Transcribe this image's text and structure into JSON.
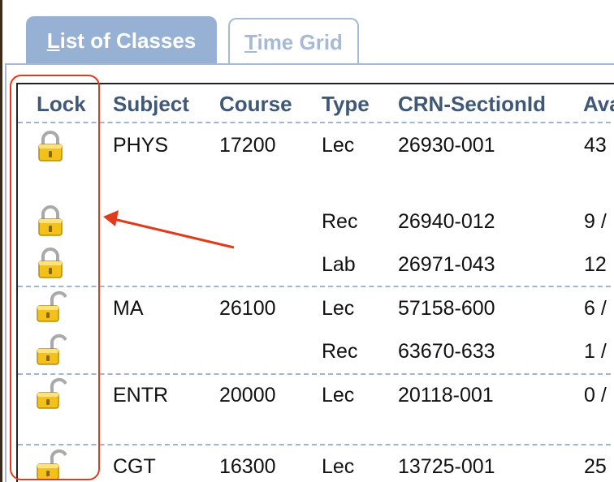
{
  "tabs": [
    {
      "label_u": "L",
      "label_rest": "ist of Classes",
      "active": true
    },
    {
      "label_u": "T",
      "label_rest": "ime Grid",
      "active": false
    }
  ],
  "table": {
    "headers": [
      "Lock",
      "Subject",
      "Course",
      "Type",
      "CRN-SectionId",
      "Ava"
    ],
    "rows": [
      {
        "lock": "locked",
        "subject": "PHYS",
        "course": "17200",
        "type": "Lec",
        "crn": "26930-001",
        "avail": "43"
      },
      {
        "lock": "locked",
        "subject": "",
        "course": "",
        "type": "Rec",
        "crn": "26940-012",
        "avail": "9 /"
      },
      {
        "lock": "locked",
        "subject": "",
        "course": "",
        "type": "Lab",
        "crn": "26971-043",
        "avail": "12"
      },
      {
        "lock": "unlocked",
        "subject": "MA",
        "course": "26100",
        "type": "Lec",
        "crn": "57158-600",
        "avail": "6 /"
      },
      {
        "lock": "unlocked",
        "subject": "",
        "course": "",
        "type": "Rec",
        "crn": "63670-633",
        "avail": "1 /"
      },
      {
        "lock": "unlocked",
        "subject": "ENTR",
        "course": "20000",
        "type": "Lec",
        "crn": "20118-001",
        "avail": "0 /"
      },
      {
        "lock": "unlocked",
        "subject": "CGT",
        "course": "16300",
        "type": "Lec",
        "crn": "13725-001",
        "avail": "25"
      }
    ]
  },
  "colors": {
    "tab_active": "#97b1d5",
    "tab_inactive_text": "#a6bad6",
    "header_text": "#3f5877",
    "row_divider": "#9fb4cf",
    "annotation": "#e23a1a",
    "lock_gold": "#f2c21b",
    "lock_shackle": "#a9a9a9"
  },
  "icons": {
    "locked": "lock-closed-icon",
    "unlocked": "lock-open-icon"
  }
}
